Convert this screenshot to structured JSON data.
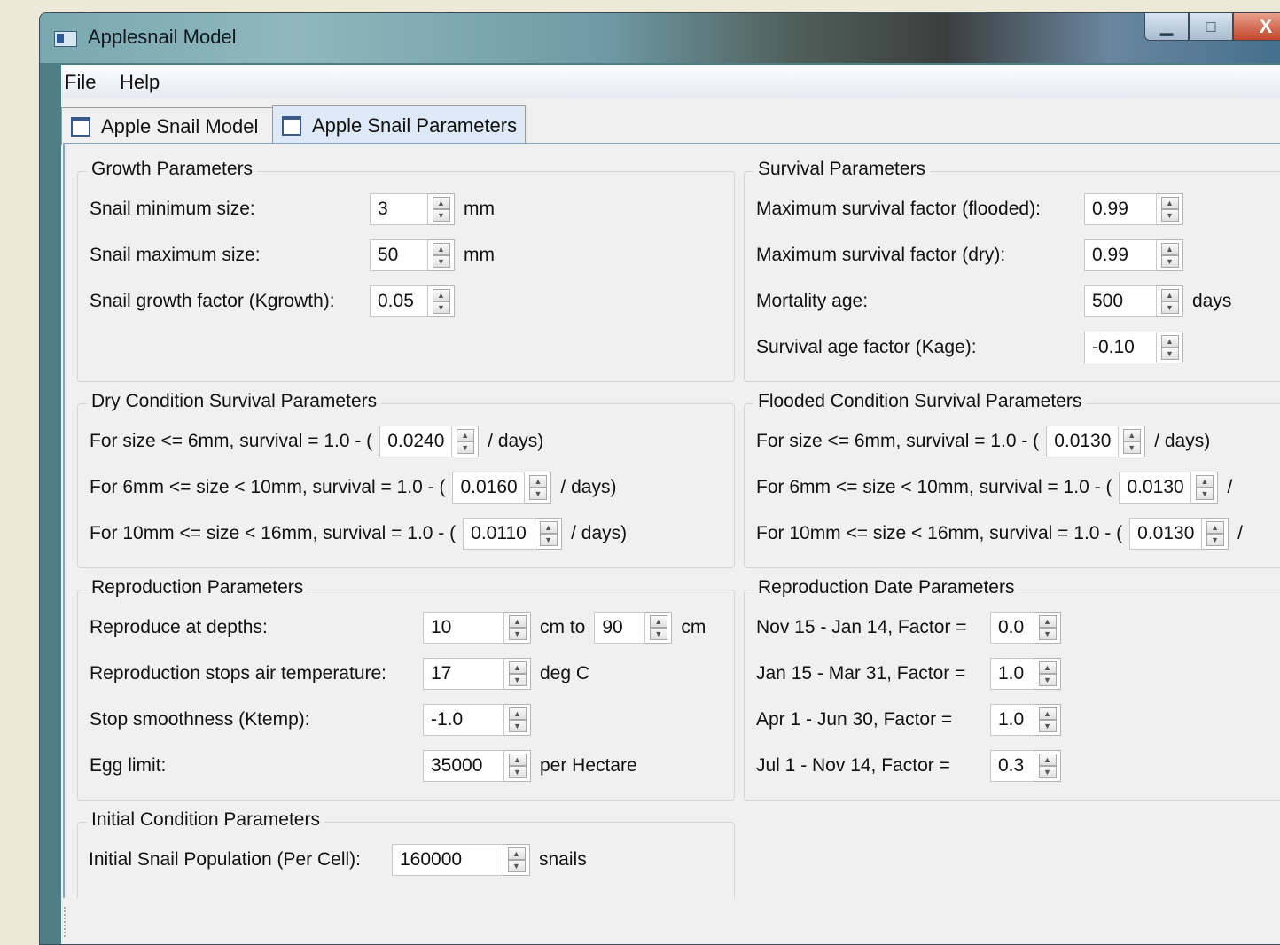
{
  "window": {
    "title": "Applesnail Model",
    "minimize": "▁",
    "maximize": "□",
    "close": "X"
  },
  "menu": {
    "file": "File",
    "help": "Help"
  },
  "tabs": [
    {
      "label": "Apple Snail Model",
      "active": false
    },
    {
      "label": "Apple Snail Parameters",
      "active": true
    }
  ],
  "growth": {
    "title": "Growth Parameters",
    "min_label": "Snail minimum size:",
    "min_value": "3",
    "min_unit": "mm",
    "max_label": "Snail maximum size:",
    "max_value": "50",
    "max_unit": "mm",
    "k_label": "Snail growth factor (Kgrowth):",
    "k_value": "0.05"
  },
  "survival": {
    "title": "Survival Parameters",
    "flooded_label": "Maximum survival factor (flooded):",
    "flooded_value": "0.99",
    "dry_label": "Maximum survival factor (dry):",
    "dry_value": "0.99",
    "mort_label": "Mortality age:",
    "mort_value": "500",
    "mort_unit": "days",
    "kage_label": "Survival age factor (Kage):",
    "kage_value": "-0.10"
  },
  "dry": {
    "title": "Dry Condition Survival Parameters",
    "r1_label": "For size <= 6mm, survival = 1.0 - (",
    "r1_value": "0.0240",
    "r1_unit": "/ days)",
    "r2_label": "For 6mm <= size < 10mm, survival = 1.0 - (",
    "r2_value": "0.0160",
    "r2_unit": "/ days)",
    "r3_label": "For 10mm <= size < 16mm, survival = 1.0 - (",
    "r3_value": "0.0110",
    "r3_unit": "/ days)"
  },
  "flooded": {
    "title": "Flooded Condition Survival Parameters",
    "r1_label": "For size <= 6mm, survival = 1.0 - (",
    "r1_value": "0.0130",
    "r1_unit": "/ days)",
    "r2_label": "For 6mm <= size < 10mm, survival = 1.0 - (",
    "r2_value": "0.0130",
    "r2_unit": "/",
    "r3_label": "For 10mm <= size < 16mm, survival = 1.0 - (",
    "r3_value": "0.0130",
    "r3_unit": "/"
  },
  "repro": {
    "title": "Reproduction Parameters",
    "depth_label": "Reproduce at depths:",
    "depth_from": "10",
    "depth_mid": "cm to",
    "depth_to": "90",
    "depth_unit": "cm",
    "temp_label": "Reproduction stops air temperature:",
    "temp_value": "17",
    "temp_unit": "deg C",
    "smooth_label": "Stop smoothness (Ktemp):",
    "smooth_value": "-1.0",
    "egg_label": "Egg limit:",
    "egg_value": "35000",
    "egg_unit": "per Hectare"
  },
  "repro_date": {
    "title": "Reproduction Date Parameters",
    "d1_label": "Nov 15 - Jan 14, Factor =",
    "d1_value": "0.0",
    "d2_label": "Jan 15 - Mar 31, Factor =",
    "d2_value": "1.0",
    "d3_label": "Apr 1 - Jun 30, Factor =",
    "d3_value": "1.0",
    "d4_label": "Jul 1 - Nov 14, Factor =",
    "d4_value": "0.3"
  },
  "initial": {
    "title": "Initial Condition Parameters",
    "pop_label": "Initial Snail Population (Per Cell):",
    "pop_value": "160000",
    "pop_unit": "snails"
  }
}
